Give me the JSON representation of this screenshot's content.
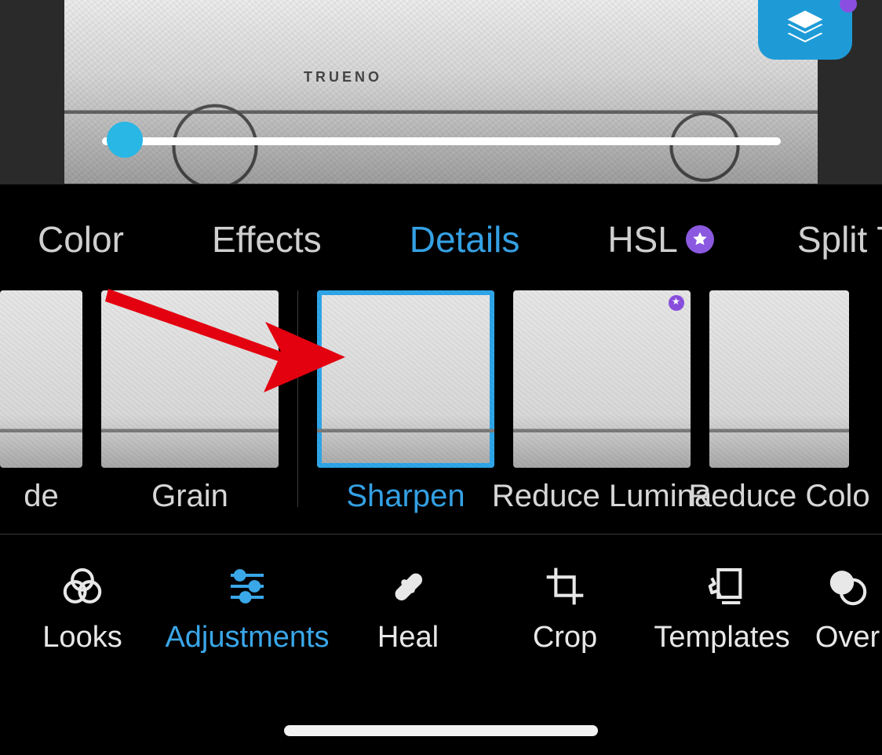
{
  "preview": {
    "car_text": "TRUENO"
  },
  "slider": {
    "value": 0,
    "min": 0,
    "max": 100
  },
  "tabs": [
    {
      "label": "Color",
      "active": false,
      "badge": false
    },
    {
      "label": "Effects",
      "active": false,
      "badge": false
    },
    {
      "label": "Details",
      "active": true,
      "badge": false
    },
    {
      "label": "HSL",
      "active": false,
      "badge": true
    },
    {
      "label": "Split Tone",
      "active": false,
      "badge": false
    }
  ],
  "thumbs": {
    "left_partial": {
      "label": "de"
    },
    "grain": {
      "label": "Grain"
    },
    "sharpen": {
      "label": "Sharpen"
    },
    "reduce_lum": {
      "label": "Reduce Lumina"
    },
    "reduce_color": {
      "label": "Reduce Colo"
    }
  },
  "toolbar": [
    {
      "id": "looks",
      "label": "Looks"
    },
    {
      "id": "adjustments",
      "label": "Adjustments"
    },
    {
      "id": "heal",
      "label": "Heal"
    },
    {
      "id": "crop",
      "label": "Crop"
    },
    {
      "id": "templates",
      "label": "Templates"
    },
    {
      "id": "overlays",
      "label": "Over"
    }
  ],
  "colors": {
    "accent": "#34a0e3",
    "premium": "#8b59e0"
  }
}
